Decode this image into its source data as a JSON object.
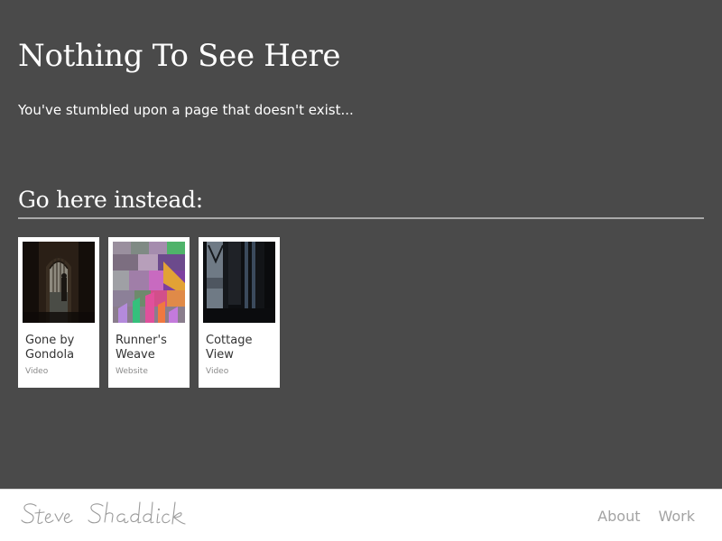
{
  "main": {
    "title": "Nothing To See Here",
    "subtitle": "You've stumbled upon a page that doesn't exist...",
    "section_heading": "Go here instead:"
  },
  "cards": [
    {
      "title": "Gone by Gondola",
      "type": "Video",
      "thumb_icon": "gondola-doorway-photo"
    },
    {
      "title": "Runner's Weave",
      "type": "Website",
      "thumb_icon": "colorful-pixel-art"
    },
    {
      "title": "Cottage View",
      "type": "Video",
      "thumb_icon": "window-silhouette-photo"
    }
  ],
  "footer": {
    "signature": "Steve Shaddick",
    "nav": [
      {
        "label": "About"
      },
      {
        "label": "Work"
      }
    ]
  },
  "colors": {
    "background": "#4a4a4a",
    "footer_background": "#ffffff",
    "rule": "#a9a9a9",
    "nav_link": "#a3a3a3",
    "card_type": "#8a8a8a"
  }
}
